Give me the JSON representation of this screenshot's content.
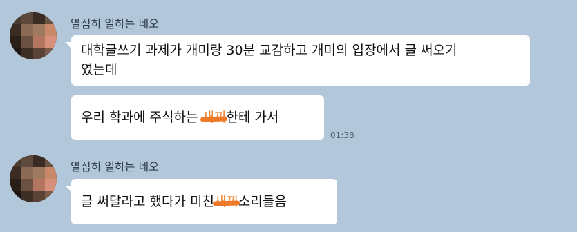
{
  "messages": [
    {
      "sender": "열심히 일하는 네오",
      "bubbles": [
        {
          "line1": "대학글쓰기 과제가 개미랑 30분 교감하고 개미의 입장에서 글 써오기",
          "line2": "였는데"
        },
        {
          "pre": "우리 학과에 주식하는 ",
          "censored": "새끼",
          "post": "한테 가서"
        }
      ],
      "time": "01:38"
    },
    {
      "sender": "열심히 일하는 네오",
      "bubbles": [
        {
          "pre": "글 써달라고 했다가 미친",
          "censored": "새끼",
          "post": "소리들음"
        }
      ]
    }
  ],
  "colors": {
    "background": "#b2c7da",
    "bubble": "#ffffff",
    "censor_mark": "#ee7a28"
  },
  "icons": {
    "avatar": "pixelated-profile-photo"
  }
}
